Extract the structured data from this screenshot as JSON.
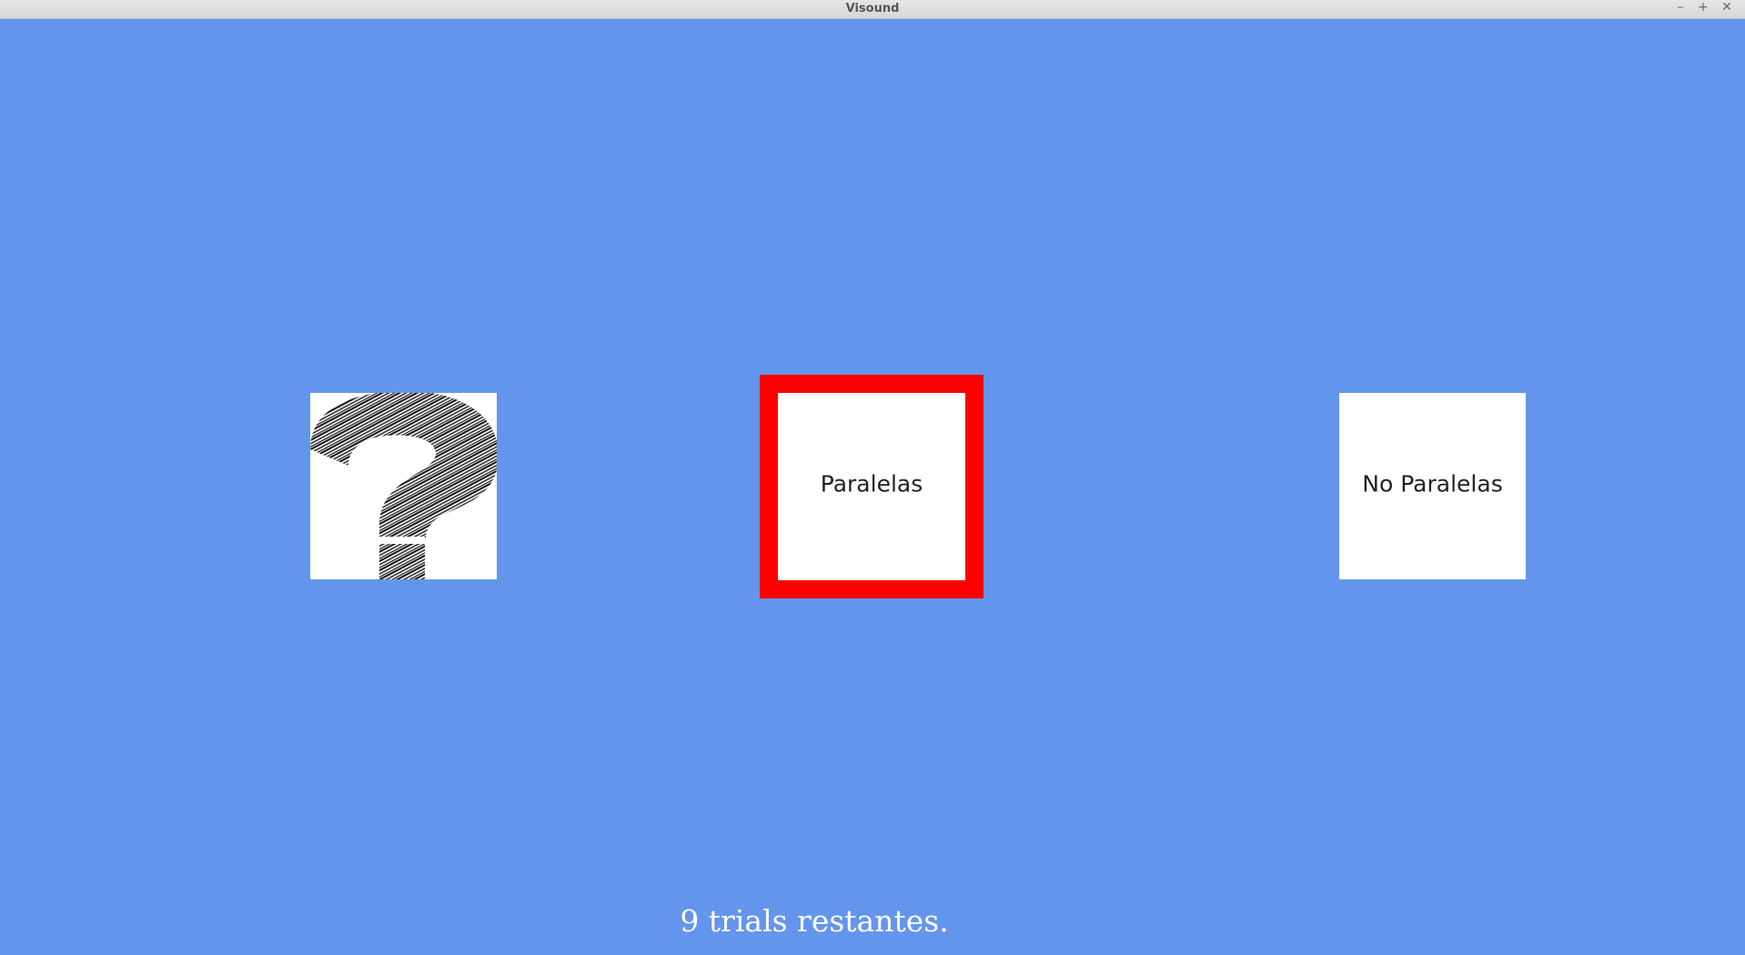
{
  "window": {
    "title": "Visound",
    "controls": {
      "minimize": "–",
      "maximize": "+",
      "close": "✕"
    }
  },
  "stimulus": {
    "icon": "question-mark-icon"
  },
  "choices": {
    "left_label": "Paralelas",
    "right_label": "No Paralelas",
    "selected": "left",
    "selected_border_color": "#ff0000"
  },
  "status": {
    "text": "9 trials restantes."
  },
  "colors": {
    "background": "#6495ed",
    "tile": "#ffffff"
  }
}
